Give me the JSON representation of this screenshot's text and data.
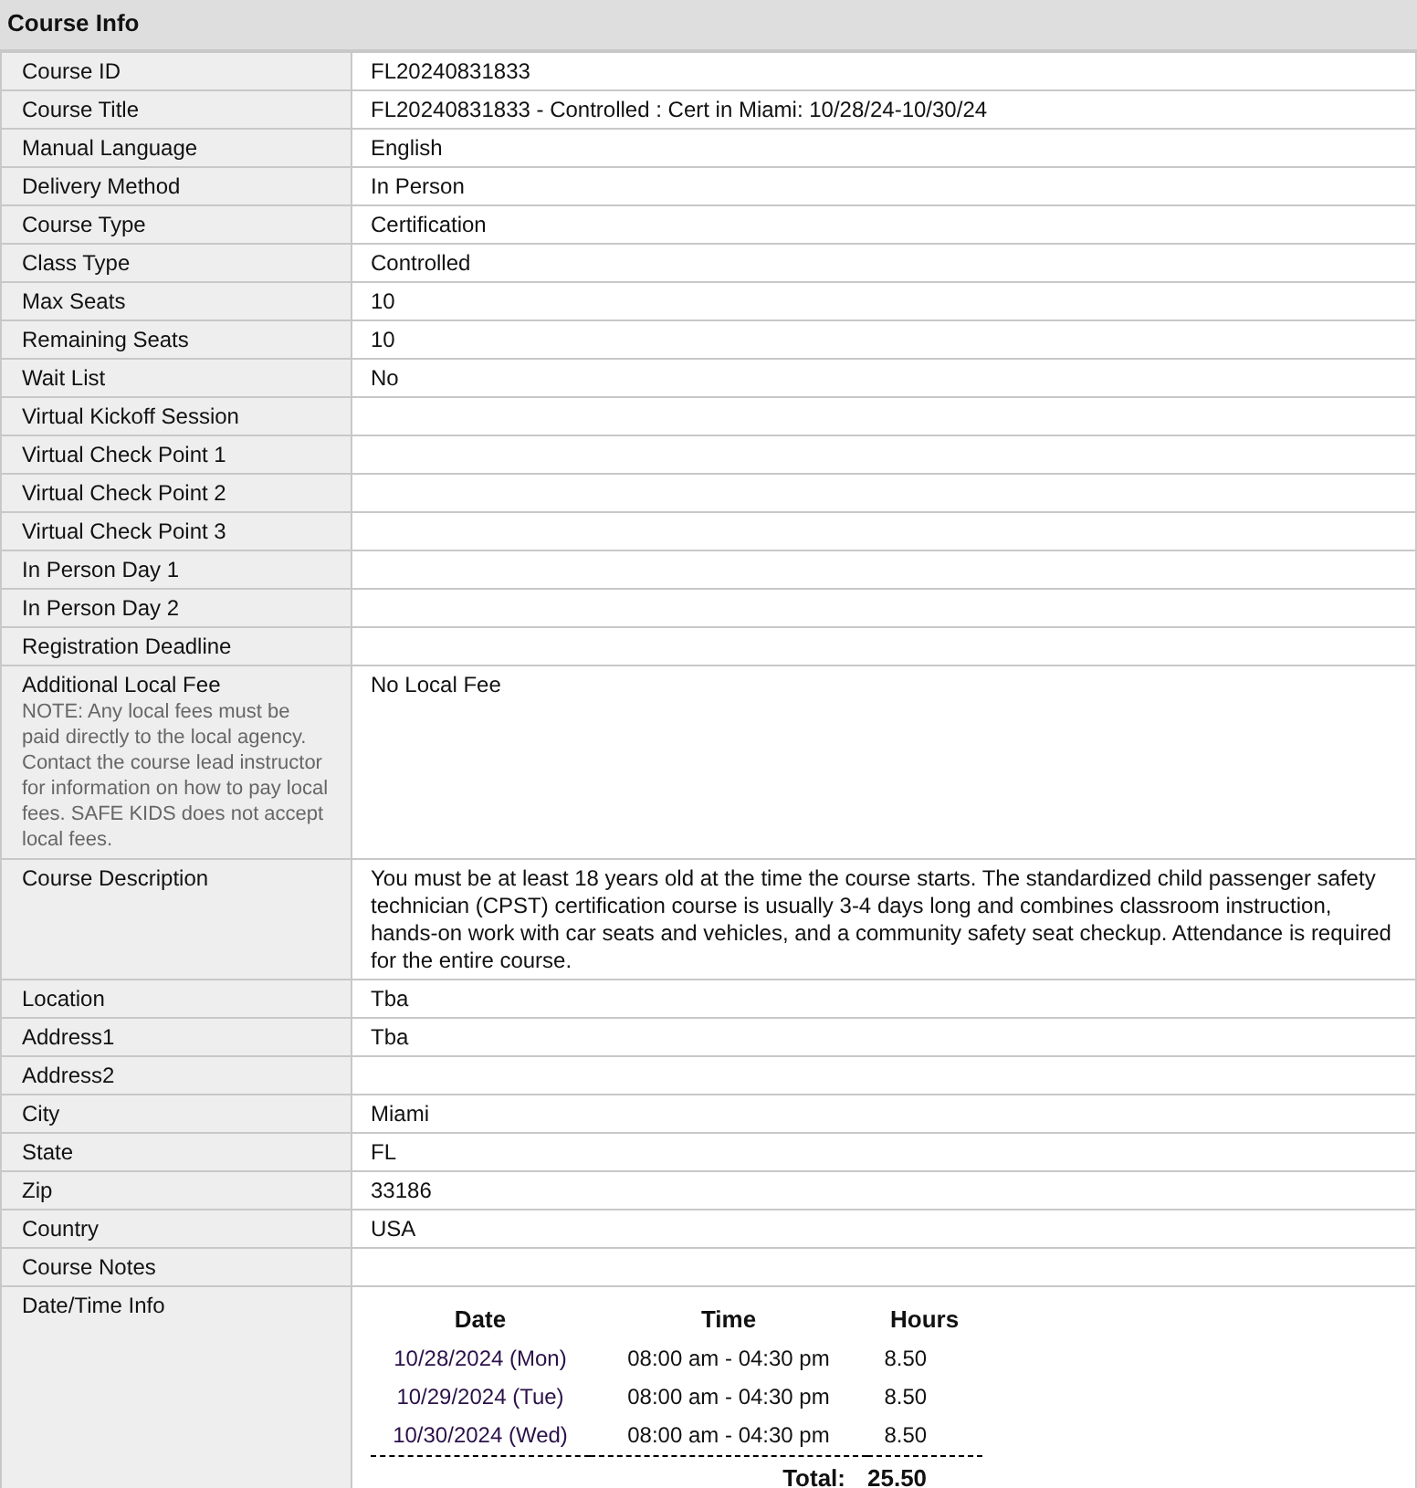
{
  "section": {
    "title": "Course Info"
  },
  "rows": [
    {
      "kind": "text",
      "label": "Course ID",
      "value": "FL20240831833"
    },
    {
      "kind": "text",
      "label": "Course Title",
      "value": "FL20240831833 - Controlled : Cert in Miami: 10/28/24-10/30/24"
    },
    {
      "kind": "text",
      "label": "Manual Language",
      "value": "English"
    },
    {
      "kind": "text",
      "label": "Delivery Method",
      "value": "In Person"
    },
    {
      "kind": "text",
      "label": "Course Type",
      "value": "Certification"
    },
    {
      "kind": "text",
      "label": "Class Type",
      "value": "Controlled"
    },
    {
      "kind": "text",
      "label": "Max Seats",
      "value": "10"
    },
    {
      "kind": "text",
      "label": "Remaining Seats",
      "value": "10"
    },
    {
      "kind": "text",
      "label": "Wait List",
      "value": "No"
    },
    {
      "kind": "text",
      "label": "Virtual Kickoff Session"
    },
    {
      "kind": "text",
      "label": "Virtual Check Point 1"
    },
    {
      "kind": "text",
      "label": "Virtual Check Point 2"
    },
    {
      "kind": "text",
      "label": "Virtual Check Point 3"
    },
    {
      "kind": "text",
      "label": "In Person Day 1"
    },
    {
      "kind": "text",
      "label": "In Person Day 2"
    },
    {
      "kind": "text",
      "label": "Registration Deadline"
    },
    {
      "kind": "text",
      "label": "Additional Local Fee",
      "note": "NOTE: Any local fees must be paid directly to the local agency. Contact the course lead instructor for information on how to pay local fees. SAFE KIDS does not accept local fees.",
      "value": "No Local Fee"
    },
    {
      "kind": "text",
      "label": "Course Description",
      "value": "You must be at least 18 years old at the time the course starts. The standardized child passenger safety technician (CPST) certification course is usually 3-4 days long and combines classroom instruction, hands-on work with car seats and vehicles, and a community safety seat checkup. Attendance is required for the entire course."
    },
    {
      "kind": "text",
      "label": "Location",
      "value": "Tba"
    },
    {
      "kind": "text",
      "label": "Address1",
      "value": "Tba"
    },
    {
      "kind": "text",
      "label": "Address2"
    },
    {
      "kind": "text",
      "label": "City",
      "value": "Miami"
    },
    {
      "kind": "text",
      "label": "State",
      "value": "FL"
    },
    {
      "kind": "text",
      "label": "Zip",
      "value": "33186"
    },
    {
      "kind": "text",
      "label": "Country",
      "value": "USA"
    },
    {
      "kind": "text",
      "label": "Course Notes"
    },
    {
      "kind": "schedule",
      "label": "Date/Time Info",
      "columns": [
        "Date",
        "Time",
        "Hours"
      ],
      "entries": [
        {
          "date": "10/28/2024 (Mon)",
          "time": "08:00 am - 04:30 pm",
          "hours": "8.50"
        },
        {
          "date": "10/29/2024 (Tue)",
          "time": "08:00 am - 04:30 pm",
          "hours": "8.50"
        },
        {
          "date": "10/30/2024 (Wed)",
          "time": "08:00 am - 04:30 pm",
          "hours": "8.50"
        }
      ],
      "total_label": "Total:",
      "total": "25.50"
    }
  ]
}
